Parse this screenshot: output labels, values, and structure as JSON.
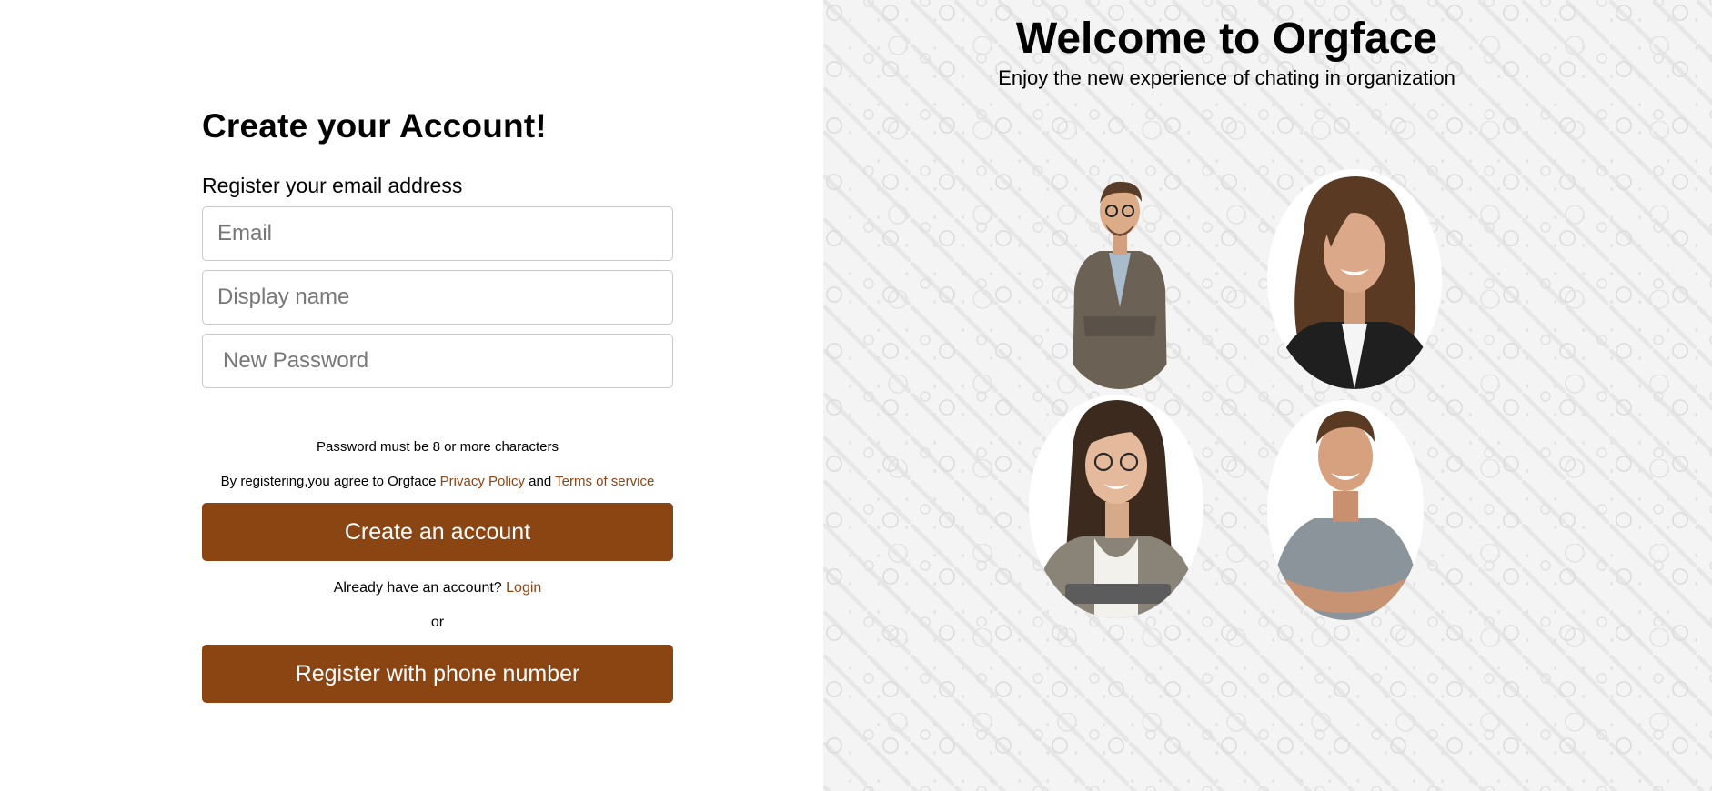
{
  "signup": {
    "title": "Create your Account!",
    "subtitle": "Register your email address",
    "email_placeholder": "Email",
    "display_name_placeholder": "Display name",
    "password_placeholder": "New Password",
    "password_hint": "Password must be 8 or more characters",
    "terms_prefix": "By registering,you agree to Orgface",
    "privacy_link": "Privacy Policy",
    "terms_and": "and",
    "terms_link": "Terms of service",
    "create_button": "Create an account",
    "have_account": "Already have an account?",
    "login_link": "Login",
    "or": "or",
    "phone_button": "Register with phone number"
  },
  "hero": {
    "title": "Welcome to Orgface",
    "tagline": "Enjoy the new experience of chating in organization",
    "people": [
      "person-man-glasses-blazer",
      "person-woman-curly-hair",
      "person-woman-glasses-tablet",
      "person-man-grey-shirt"
    ]
  },
  "colors": {
    "accent": "#8b4513",
    "pattern_bg": "#f4f4f4"
  }
}
